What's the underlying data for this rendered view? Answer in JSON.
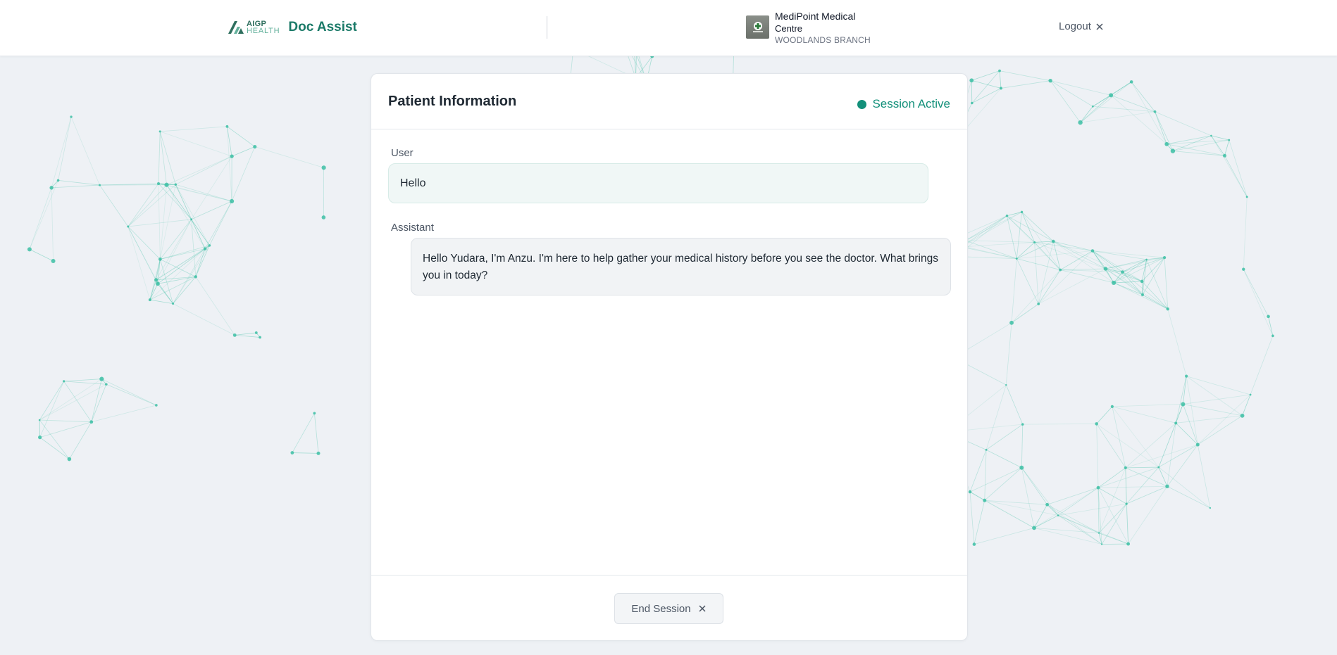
{
  "header": {
    "logo_line1": "AIGP",
    "logo_line2": "HEALTH",
    "app_name": "Doc Assist",
    "clinic": {
      "name_line1": "MediPoint Medical",
      "name_line2": "Centre",
      "branch": "WOODLANDS BRANCH"
    },
    "logout_label": "Logout",
    "icons": {
      "logo": "aigp-logo-icon",
      "clinic_logo": "clinic-logo-icon",
      "logout": "close-icon"
    }
  },
  "card": {
    "title": "Patient Information",
    "status": {
      "label": "Session Active",
      "color": "#13907a"
    },
    "messages": [
      {
        "role": "User",
        "text": "Hello"
      },
      {
        "role": "Assistant",
        "text": "Hello Yudara, I'm Anzu. I'm here to help gather your medical history before you see the doctor. What brings you in today?"
      }
    ],
    "end_session_label": "End Session"
  },
  "colors": {
    "accent": "#13907a",
    "brand": "#1b7a68",
    "network": "#3dbfa4"
  }
}
